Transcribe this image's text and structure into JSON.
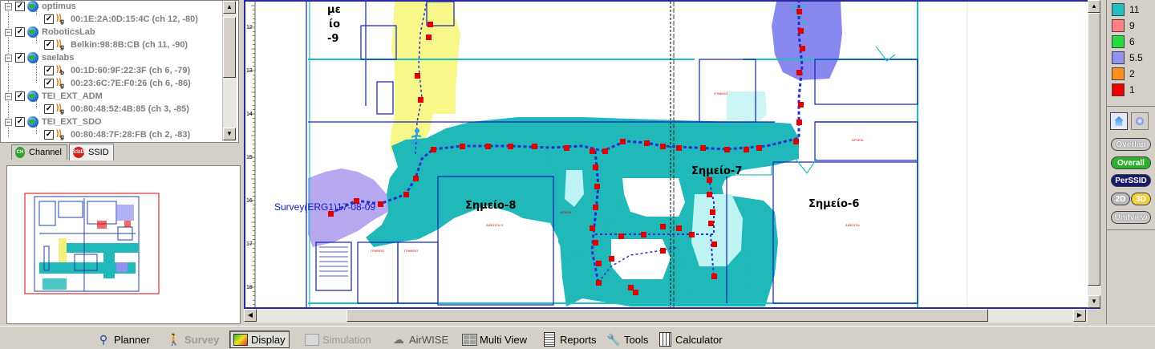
{
  "tree": {
    "rows": [
      {
        "type": "ssid",
        "label": "optimus"
      },
      {
        "type": "ap",
        "mode": "g",
        "label": "00:1E:2A:0D:15:4C (ch 12, -80)"
      },
      {
        "type": "ssid",
        "label": "RoboticsLab"
      },
      {
        "type": "ap",
        "mode": "g",
        "label": "Belkin:98:8B:CB (ch 11, -90)"
      },
      {
        "type": "ssid",
        "label": "saelabs"
      },
      {
        "type": "ap",
        "mode": "b",
        "label": "00:1D:60:9F:22:3F (ch 6, -79)"
      },
      {
        "type": "ap",
        "mode": "g",
        "label": "00:23:6C:7E:F0:26 (ch 6, -86)"
      },
      {
        "type": "ssid",
        "label": "TEI_EXT_ADM"
      },
      {
        "type": "ap",
        "mode": "g",
        "label": "00:80:48:52:4B:85 (ch 3, -85)"
      },
      {
        "type": "ssid",
        "label": "TEI_EXT_SDO"
      },
      {
        "type": "ap",
        "mode": "g",
        "label": "00:80:48:7F:28:FB (ch 2, -83)"
      }
    ]
  },
  "tabs": [
    {
      "label": "Channel",
      "icon": "CH"
    },
    {
      "label": "SSID",
      "icon": "SSID"
    }
  ],
  "map": {
    "labels": {
      "room9_a": "με",
      "room9_b": "ίο",
      "room9_c": "-9",
      "room8": "Σημείο-8",
      "room7": "Σημείο-7",
      "room6": "Σημείο-6",
      "survey": "Survey(ERG1)17-08-09"
    },
    "ruler": [
      "12",
      "13",
      "14",
      "15",
      "16",
      "17",
      "18"
    ],
    "small_labels": [
      "ΓΡΑΦΕΙΟ",
      "ΑΡΧΕΙΑ",
      "ΓΡΑΦΕΙΟ",
      "ΓΡΑΦΕΙΟ",
      "ΑΙΘΟΥΣΑ 3",
      "ΑΡΧΕΙΑ",
      "ΑΙΘΟΥΣΑ"
    ]
  },
  "legend": {
    "items": [
      {
        "value": "11",
        "color": "#20c0c0"
      },
      {
        "value": "9",
        "color": "#ff8080"
      },
      {
        "value": "6",
        "color": "#20e040"
      },
      {
        "value": "5.5",
        "color": "#9090f0"
      },
      {
        "value": "2",
        "color": "#ff9020"
      },
      {
        "value": "1",
        "color": "#ee0000"
      }
    ],
    "buttons": {
      "overlap": "Overlap",
      "overall": "Overall",
      "perssid": "PerSSID",
      "two_d": "2D",
      "three_d": "3D",
      "unifview": "Unifview"
    }
  },
  "toolbar": [
    {
      "label": "Planner",
      "icon": "planner-icon",
      "state": "normal"
    },
    {
      "label": "Survey",
      "icon": "survey-icon",
      "state": "disabled"
    },
    {
      "label": "Display",
      "icon": "display-icon",
      "state": "selected"
    },
    {
      "label": "Simulation",
      "icon": "simulation-icon",
      "state": "disabled"
    },
    {
      "label": "AirWISE",
      "icon": "airwise-icon",
      "state": "disabled"
    },
    {
      "label": "Multi View",
      "icon": "multiview-icon",
      "state": "normal"
    },
    {
      "label": "Reports",
      "icon": "reports-icon",
      "state": "normal"
    },
    {
      "label": "Tools",
      "icon": "tools-icon",
      "state": "normal"
    },
    {
      "label": "Calculator",
      "icon": "calculator-icon",
      "state": "normal"
    }
  ]
}
